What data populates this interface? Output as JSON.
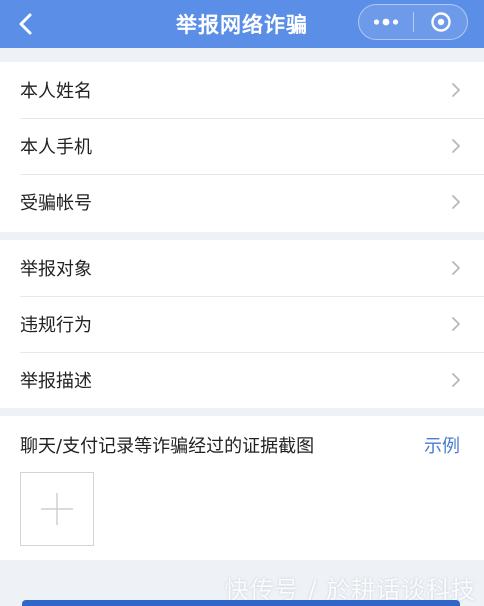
{
  "header": {
    "title": "举报网络诈骗",
    "bg_color": "#5b8ee6",
    "back_icon": "chevron-left-icon",
    "more_icon": "more-dots-icon",
    "close_icon": "target-close-icon"
  },
  "groups": [
    {
      "items": [
        {
          "label": "本人姓名"
        },
        {
          "label": "本人手机"
        },
        {
          "label": "受骗帐号"
        }
      ]
    },
    {
      "items": [
        {
          "label": "举报对象"
        },
        {
          "label": "违规行为"
        },
        {
          "label": "举报描述"
        }
      ]
    }
  ],
  "evidence": {
    "title": "聊天/支付记录等诈骗经过的证据截图",
    "example_label": "示例",
    "example_color": "#4a7ccf",
    "upload_icon": "plus-icon"
  },
  "watermark": "快传号 / 於耕话谈科技"
}
